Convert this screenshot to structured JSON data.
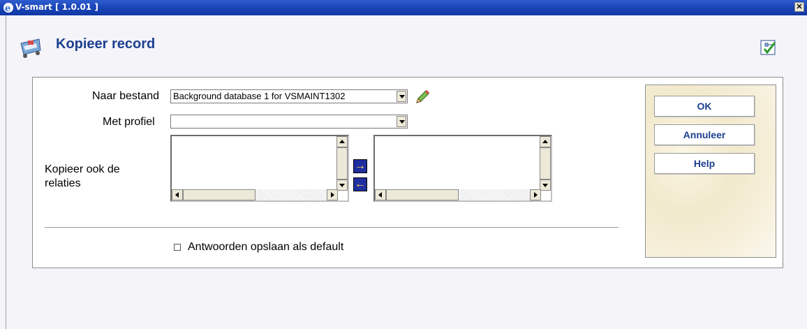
{
  "window": {
    "title": "V-smart [ 1.0.01 ]",
    "close_glyph": "✕"
  },
  "page": {
    "title": "Kopieer record"
  },
  "form": {
    "naar_bestand_label": "Naar bestand",
    "naar_bestand_value": "Background database 1 for VSMAINT1302",
    "met_profiel_label": "Met profiel",
    "met_profiel_value": "",
    "relaties_label": "Kopieer ook de relaties",
    "move_right_glyph": "→",
    "move_left_glyph": "←",
    "default_checkbox_label": "Antwoorden opslaan als default",
    "default_checked": false
  },
  "buttons": {
    "ok": "OK",
    "cancel": "Annuleer",
    "help": "Help"
  },
  "icons": {
    "browser": "ie-icon",
    "page": "record-cart-icon",
    "edit": "pencil-icon",
    "corner": "workflow-check-icon"
  },
  "colors": {
    "titlebar": "#1c47b9",
    "title_text": "#1c3f8f",
    "mover_bg": "#1f2fa0",
    "mover_arrow": "#ffe35a"
  }
}
